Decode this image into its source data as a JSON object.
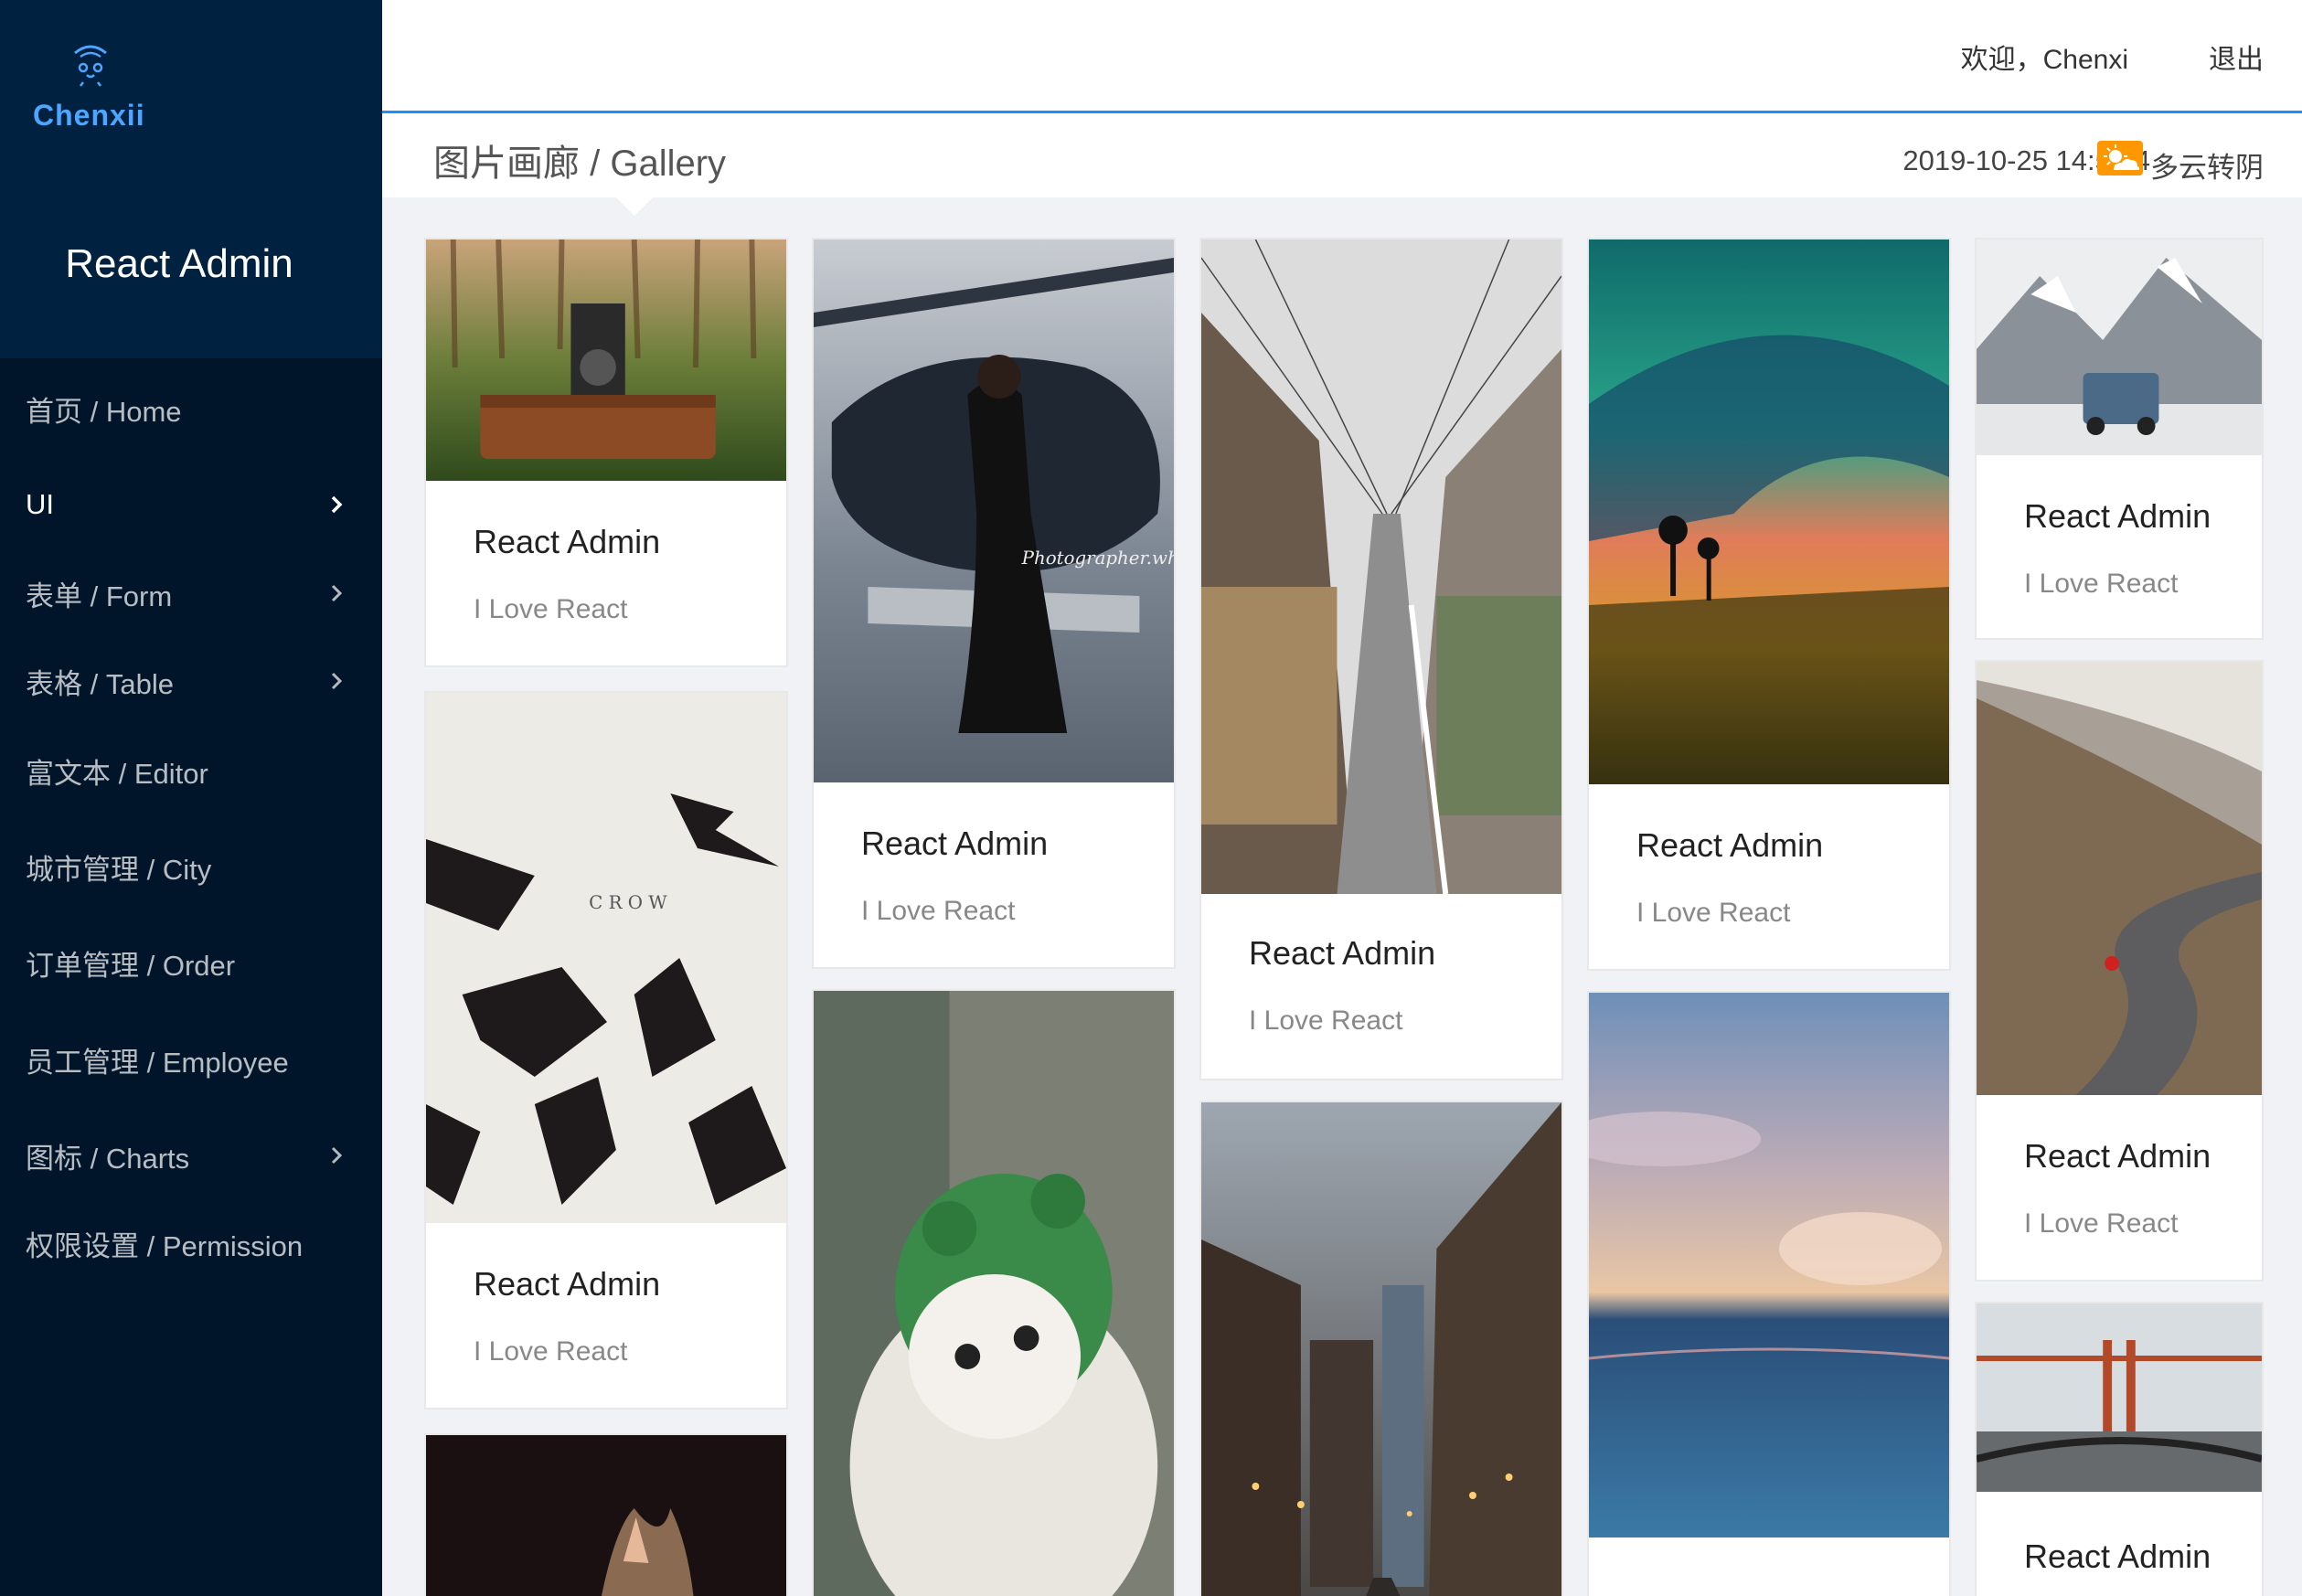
{
  "brand": {
    "logo_text": "Chenxii",
    "app_title": "React Admin"
  },
  "menu": [
    {
      "label": "首页 / Home",
      "submenu": false,
      "active": false
    },
    {
      "label": "UI",
      "submenu": true,
      "active": true
    },
    {
      "label": "表单 / Form",
      "submenu": true,
      "active": false
    },
    {
      "label": "表格 / Table",
      "submenu": true,
      "active": false
    },
    {
      "label": "富文本 / Editor",
      "submenu": false,
      "active": false
    },
    {
      "label": "城市管理 / City",
      "submenu": false,
      "active": false
    },
    {
      "label": "订单管理 / Order",
      "submenu": false,
      "active": false
    },
    {
      "label": "员工管理 / Employee",
      "submenu": false,
      "active": false
    },
    {
      "label": "图标 / Charts",
      "submenu": true,
      "active": false
    },
    {
      "label": "权限设置 / Permission",
      "submenu": false,
      "active": false
    }
  ],
  "header": {
    "welcome": "欢迎，Chenxi",
    "logout": "退出"
  },
  "breadcrumb": {
    "title": "图片画廊 / Gallery",
    "datetime": "2019-10-25 14:56:4",
    "weather": "多云转阴",
    "weather_icon": "partly-cloudy-icon"
  },
  "gallery": {
    "card_title": "React Admin",
    "card_desc": "I Love React",
    "columns": [
      [
        {
          "image": "vintage-camera-suitcase-forest"
        },
        {
          "image": "crows-illustration",
          "caption": "C R O W"
        },
        {
          "image": "cat-closeup-dark"
        }
      ],
      [
        {
          "image": "woman-helicopter",
          "caption": "Photographer.why"
        },
        {
          "image": "kitten-frog-hat"
        }
      ],
      [
        {
          "image": "japanese-street"
        },
        {
          "image": "city-street-dusk"
        }
      ],
      [
        {
          "image": "ocean-wave-sunset"
        },
        {
          "image": "sea-sky-clouds"
        }
      ],
      [
        {
          "image": "snowy-mountain-car"
        },
        {
          "image": "mountain-road-skater"
        },
        {
          "image": "golden-gate-bridge-drive"
        }
      ]
    ]
  },
  "colors": {
    "sidebar_bg": "#001529",
    "logo_bg": "#002140",
    "accent": "#1890ff",
    "content_bg": "#f0f2f5"
  }
}
